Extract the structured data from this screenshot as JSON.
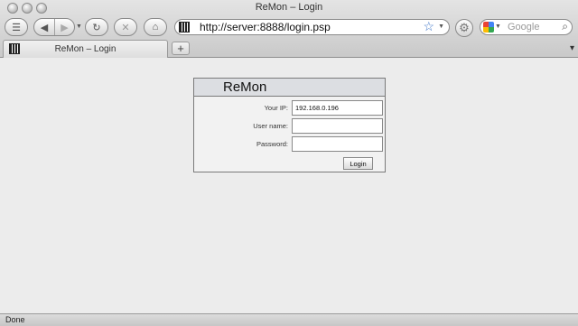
{
  "window": {
    "title": "ReMon – Login"
  },
  "toolbar": {
    "url": "http://server:8888/login.psp",
    "search_placeholder": "Google"
  },
  "tabs": [
    {
      "label": "ReMon – Login"
    }
  ],
  "icons": {
    "back": "◀",
    "forward": "▶",
    "reload": "↻",
    "stop": "✕",
    "home": "⌂",
    "star": "☆",
    "gear": "⚙",
    "search": "⌕",
    "new_tab": "+",
    "tab_list": "▾",
    "bookmarks": "☰"
  },
  "login": {
    "header": "ReMon",
    "ip_label": "Your IP:",
    "ip_value": "192.168.0.196",
    "username_label": "User name:",
    "username_value": "",
    "password_label": "Password:",
    "password_value": "",
    "button_label": "Login"
  },
  "status": {
    "text": "Done"
  }
}
